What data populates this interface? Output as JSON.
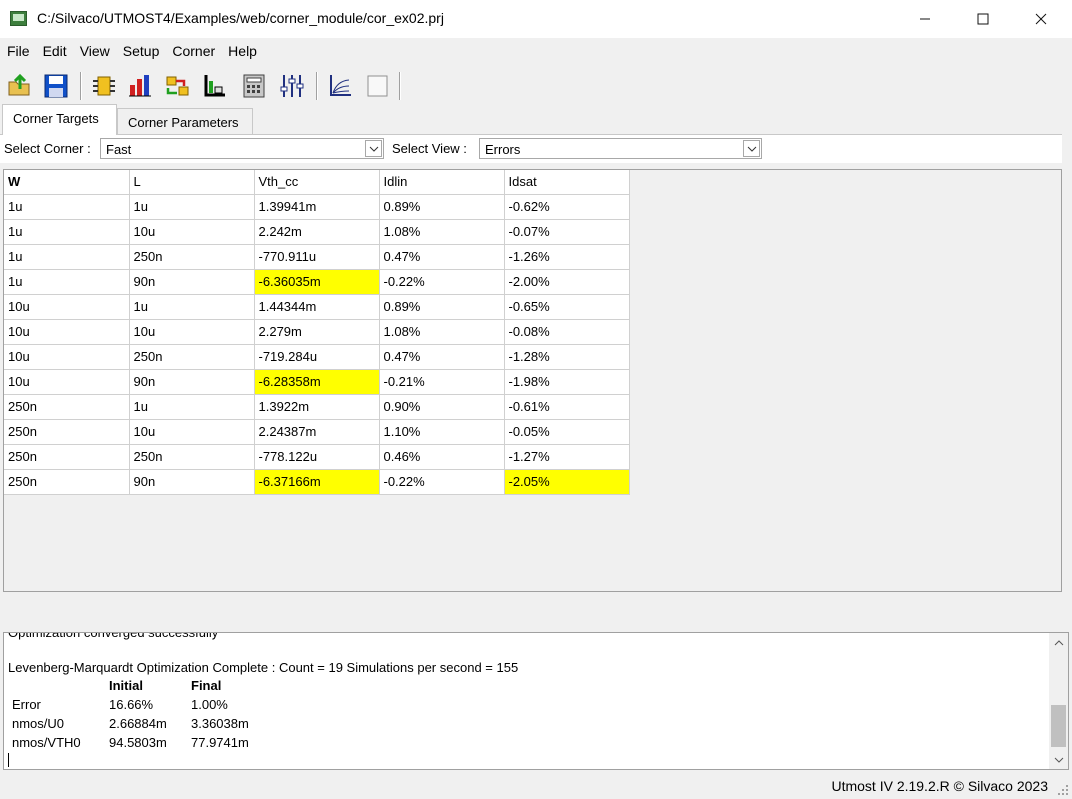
{
  "window": {
    "title": "C:/Silvaco/UTMOST4/Examples/web/corner_module/cor_ex02.prj"
  },
  "menu": [
    "File",
    "Edit",
    "View",
    "Setup",
    "Corner",
    "Help"
  ],
  "toolbar_icons": [
    "open-folder-icon",
    "save-icon",
    "module-icon",
    "bar-chart-icon",
    "transfer-icon",
    "bracket-chart-icon",
    "calculator-icon",
    "sliders-icon",
    "curve-plot-icon",
    "blank-page-icon"
  ],
  "tabs": [
    "Corner Targets",
    "Corner Parameters"
  ],
  "selectors": {
    "corner_label": "Select Corner :",
    "corner_value": "Fast",
    "view_label": "Select View :",
    "view_value": "Errors"
  },
  "table": {
    "headers": [
      "W",
      "L",
      "Vth_cc",
      "Idlin",
      "Idsat"
    ],
    "rows": [
      {
        "cells": [
          "1u",
          "1u",
          "1.39941m",
          "0.89%",
          "-0.62%"
        ],
        "hl": []
      },
      {
        "cells": [
          "1u",
          "10u",
          "2.242m",
          "1.08%",
          "-0.07%"
        ],
        "hl": []
      },
      {
        "cells": [
          "1u",
          "250n",
          "-770.911u",
          "0.47%",
          "-1.26%"
        ],
        "hl": []
      },
      {
        "cells": [
          "1u",
          "90n",
          "-6.36035m",
          "-0.22%",
          "-2.00%"
        ],
        "hl": [
          2
        ]
      },
      {
        "cells": [
          "10u",
          "1u",
          "1.44344m",
          "0.89%",
          "-0.65%"
        ],
        "hl": []
      },
      {
        "cells": [
          "10u",
          "10u",
          "2.279m",
          "1.08%",
          "-0.08%"
        ],
        "hl": []
      },
      {
        "cells": [
          "10u",
          "250n",
          "-719.284u",
          "0.47%",
          "-1.28%"
        ],
        "hl": []
      },
      {
        "cells": [
          "10u",
          "90n",
          "-6.28358m",
          "-0.21%",
          "-1.98%"
        ],
        "hl": [
          2
        ]
      },
      {
        "cells": [
          "250n",
          "1u",
          "1.3922m",
          "0.90%",
          "-0.61%"
        ],
        "hl": []
      },
      {
        "cells": [
          "250n",
          "10u",
          "2.24387m",
          "1.10%",
          "-0.05%"
        ],
        "hl": []
      },
      {
        "cells": [
          "250n",
          "250n",
          "-778.122u",
          "0.46%",
          "-1.27%"
        ],
        "hl": []
      },
      {
        "cells": [
          "250n",
          "90n",
          "-6.37166m",
          "-0.22%",
          "-2.05%"
        ],
        "hl": [
          2,
          4
        ]
      }
    ],
    "highlight_color": "#ffff00"
  },
  "log": {
    "partial_line": "Optimization converged successfully",
    "summary": "Levenberg-Marquardt Optimization Complete : Count = 19  Simulations per second = 155",
    "col_initial": "Initial",
    "col_final": "Final",
    "rows": [
      {
        "name": "Error",
        "initial": "16.66%",
        "final": "1.00%"
      },
      {
        "name": "nmos/U0",
        "initial": "2.66884m",
        "final": "3.36038m"
      },
      {
        "name": "nmos/VTH0",
        "initial": "94.5803m",
        "final": "77.9741m"
      }
    ]
  },
  "status": {
    "text": "Utmost IV 2.19.2.R © Silvaco 2023"
  }
}
